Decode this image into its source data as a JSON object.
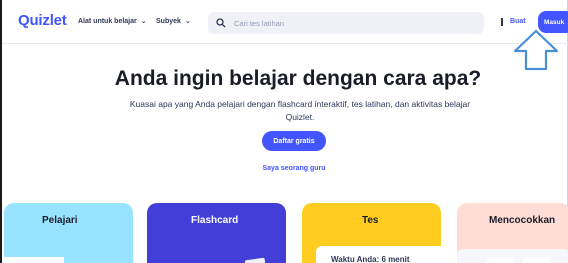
{
  "header": {
    "logo": "Quizlet",
    "nav": [
      {
        "label": "Alat untuk belajar",
        "chevron": "⌄"
      },
      {
        "label": "Subyek",
        "chevron": "⌄"
      }
    ],
    "search": {
      "placeholder": "Cari tes latihan",
      "icon": "search-icon"
    },
    "create_label": "Buat",
    "login_label": "Masuk"
  },
  "hero": {
    "title": "Anda ingin belajar dengan cara apa?",
    "subtitle": "Kuasai apa yang Anda pelajari dengan flashcard interaktif, tes latihan, dan aktivitas belajar Quizlet.",
    "cta_label": "Daftar gratis",
    "teacher_link": "Saya seorang guru"
  },
  "cards": [
    {
      "title": "Pelajari",
      "color": "#98e3ff"
    },
    {
      "title": "Flashcard",
      "color": "#423ed8"
    },
    {
      "title": "Tes",
      "color": "#ffcd1f",
      "preview_text": "Waktu Anda: 6 menit"
    },
    {
      "title": "Mencocokkan",
      "color": "#ffdcd6"
    }
  ],
  "colors": {
    "brand": "#4255ff",
    "text": "#2e3856",
    "annotation_arrow": "#4a8fd6"
  }
}
